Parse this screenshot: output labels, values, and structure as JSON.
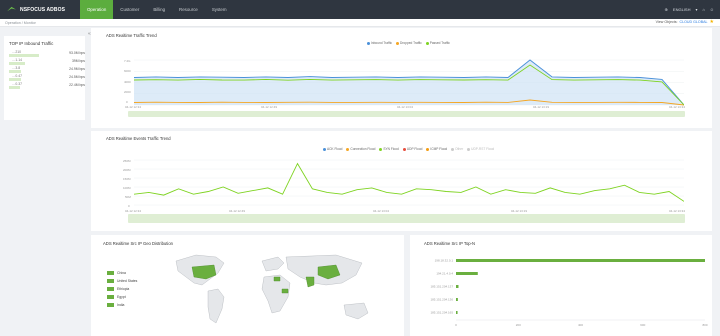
{
  "app": {
    "brand": "NSFOCUS ADBOS",
    "nav": [
      "Operation",
      "Customer",
      "Billing",
      "Resource",
      "System"
    ],
    "language": "ENGLISH",
    "breadcrumb": "Operation / Monitor",
    "view_objects_label": "View Objects:",
    "view_objects_value": "CLOUD GLOBAL"
  },
  "sidebar": {
    "title": "TOP IP Inbound Traffic",
    "items": [
      {
        "ip": "…210",
        "value": "93.0M bps",
        "level": 1.0
      },
      {
        "ip": "…1.14",
        "value": "39M bps",
        "level": 0.54
      },
      {
        "ip": "…3.8",
        "value": "24.9M bps",
        "level": 0.4
      },
      {
        "ip": "…0.47",
        "value": "24.5M bps",
        "level": 0.39
      },
      {
        "ip": "…0.37",
        "value": "22.4M bps",
        "level": 0.35
      }
    ]
  },
  "charts": {
    "traffic": {
      "title": "ADS Realtime Traffic Trend",
      "legend": [
        "Inbound Traffic",
        "Dropped Traffic",
        "Passed Traffic"
      ],
      "yticks": [
        "7.2G",
        "6000",
        "4000",
        "2000",
        "0"
      ],
      "xticks": [
        "04-12 12:34",
        "04-12 12:49",
        "04-12 13:04",
        "04-12 13:19",
        "04-12 13:34"
      ]
    },
    "events": {
      "title": "ADS Realtime Events Traffic Trend",
      "legend": [
        "ACK Flood",
        "Connection Flood",
        "SYN Flood",
        "UDP Flood",
        "ICMP Flood",
        "Other",
        "UDP-RST Flood"
      ],
      "yticks": [
        "250M",
        "200M",
        "150M",
        "100M",
        "50M",
        "0"
      ],
      "xticks": [
        "04-12 12:34",
        "04-12 12:49",
        "04-12 13:04",
        "04-12 13:19",
        "04-12 13:34"
      ]
    },
    "geo": {
      "title": "ADS Realtime Src IP Geo Distribution",
      "legend": [
        "China",
        "United States",
        "Ethiopia",
        "Egypt",
        "India"
      ]
    },
    "topn": {
      "title": "ADS Realtime Src IP Top-N",
      "labels": [
        "198.18.32.0.1",
        "194.21.4.0.4",
        "185.151.204.137",
        "185.151.204.136",
        "185.151.204.165"
      ],
      "xticks": [
        "0",
        "200",
        "400",
        "600",
        "800"
      ]
    }
  },
  "chart_data": [
    {
      "type": "area",
      "title": "ADS Realtime Traffic Trend",
      "x": [
        "04-12 12:34",
        "04-12 12:49",
        "04-12 13:04",
        "04-12 13:19",
        "04-12 13:34"
      ],
      "series": [
        {
          "name": "Inbound Traffic",
          "values": [
            4400,
            4500,
            4400,
            4500,
            4450,
            4400,
            4500,
            4400,
            4550,
            4400,
            4450,
            4500,
            4400,
            4500,
            4450,
            4400,
            4500,
            4400,
            7200,
            4500,
            4400,
            4450,
            4500,
            4400,
            4100,
            0
          ]
        },
        {
          "name": "Dropped Traffic",
          "values": [
            400,
            450,
            420,
            400,
            450,
            420,
            400,
            430,
            450,
            410,
            420,
            440,
            410,
            430,
            420,
            400,
            450,
            420,
            800,
            430,
            420,
            410,
            440,
            420,
            400,
            0
          ]
        },
        {
          "name": "Passed Traffic",
          "values": [
            4000,
            4050,
            3980,
            4100,
            4000,
            3980,
            4100,
            3970,
            4100,
            3990,
            4030,
            4060,
            3990,
            4070,
            4030,
            4000,
            4050,
            3980,
            6400,
            4070,
            3980,
            4040,
            4060,
            3980,
            3700,
            0
          ]
        }
      ],
      "colors": [
        "#4a90d9",
        "#f5a623",
        "#7ed321"
      ]
    },
    {
      "type": "line",
      "title": "ADS Realtime Events Traffic Trend",
      "x": [
        "04-12 12:34",
        "04-12 12:49",
        "04-12 13:04",
        "04-12 13:19",
        "04-12 13:34"
      ],
      "series": [
        {
          "name": "SYN Flood",
          "values": [
            60,
            70,
            55,
            90,
            60,
            75,
            100,
            65,
            80,
            95,
            60,
            230,
            90,
            70,
            60,
            85,
            95,
            70,
            60,
            90,
            85,
            75,
            70,
            100,
            60,
            85,
            70,
            65,
            95,
            70,
            60,
            80,
            90,
            110,
            70,
            60,
            75,
            20
          ]
        }
      ]
    },
    {
      "type": "bar",
      "title": "ADS Realtime Src IP Top-N",
      "categories": [
        "198.18.32.0.1",
        "194.21.4.0.4",
        "185.151.204.137",
        "185.151.204.136",
        "185.151.204.165"
      ],
      "values": [
        800,
        70,
        8,
        6,
        5
      ],
      "xlim": [
        0,
        800
      ]
    }
  ]
}
